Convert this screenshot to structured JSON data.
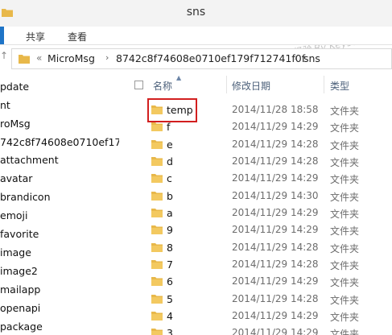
{
  "window": {
    "title": "sns"
  },
  "watermark": "百度经验 By Key9928",
  "ribbon": {
    "tabs": [
      "共享",
      "查看"
    ]
  },
  "address": {
    "overflow": "«",
    "crumbs": [
      "MicroMsg",
      "8742c8f74608e0710ef179f712741f0f",
      "sns"
    ],
    "separator": "›"
  },
  "navpane": {
    "items": [
      "pdate",
      "nt",
      "roMsg",
      "742c8f74608e0710ef179",
      "attachment",
      "avatar",
      "brandicon",
      "emoji",
      "favorite",
      "image",
      "image2",
      "mailapp",
      "openapi",
      "package"
    ]
  },
  "filelist": {
    "headers": {
      "name": "名称",
      "modified": "修改日期",
      "type": "类型"
    },
    "rows": [
      {
        "name": "temp",
        "modified": "2014/11/28 18:58",
        "type": "文件夹"
      },
      {
        "name": "f",
        "modified": "2014/11/29 14:29",
        "type": "文件夹"
      },
      {
        "name": "e",
        "modified": "2014/11/29 14:28",
        "type": "文件夹"
      },
      {
        "name": "d",
        "modified": "2014/11/29 14:28",
        "type": "文件夹"
      },
      {
        "name": "c",
        "modified": "2014/11/29 14:29",
        "type": "文件夹"
      },
      {
        "name": "b",
        "modified": "2014/11/29 14:30",
        "type": "文件夹"
      },
      {
        "name": "a",
        "modified": "2014/11/29 14:29",
        "type": "文件夹"
      },
      {
        "name": "9",
        "modified": "2014/11/29 14:29",
        "type": "文件夹"
      },
      {
        "name": "8",
        "modified": "2014/11/29 14:28",
        "type": "文件夹"
      },
      {
        "name": "7",
        "modified": "2014/11/29 14:28",
        "type": "文件夹"
      },
      {
        "name": "6",
        "modified": "2014/11/29 14:29",
        "type": "文件夹"
      },
      {
        "name": "5",
        "modified": "2014/11/29 14:28",
        "type": "文件夹"
      },
      {
        "name": "4",
        "modified": "2014/11/29 14:29",
        "type": "文件夹"
      },
      {
        "name": "3",
        "modified": "2014/11/29 14:29",
        "type": "文件夹"
      }
    ]
  },
  "colors": {
    "folder": "#e8b84a",
    "highlight": "#d21f1f",
    "header_text": "#4c607a"
  }
}
